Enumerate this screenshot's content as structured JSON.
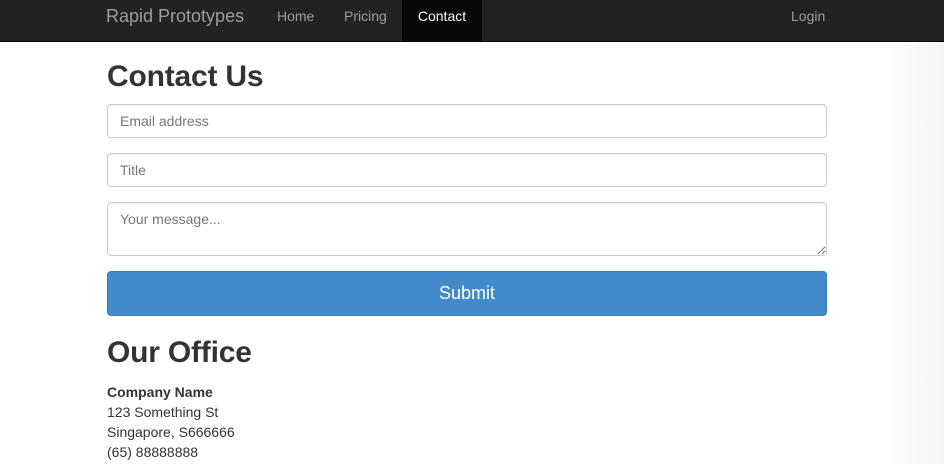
{
  "navbar": {
    "brand": "Rapid Prototypes",
    "links": [
      {
        "label": "Home"
      },
      {
        "label": "Pricing"
      },
      {
        "label": "Contact",
        "active": true
      }
    ],
    "login": "Login"
  },
  "contact": {
    "heading": "Contact Us",
    "email_placeholder": "Email address",
    "title_placeholder": "Title",
    "message_placeholder": "Your message...",
    "submit_label": "Submit"
  },
  "office": {
    "heading": "Our Office",
    "company": "Company Name",
    "street": "123 Something St",
    "city": "Singapore, S666666",
    "phone": "(65) 88888888"
  },
  "colors": {
    "navbar_bg": "#222222",
    "active_nav_bg": "#080808",
    "primary_button": "#428bca"
  }
}
